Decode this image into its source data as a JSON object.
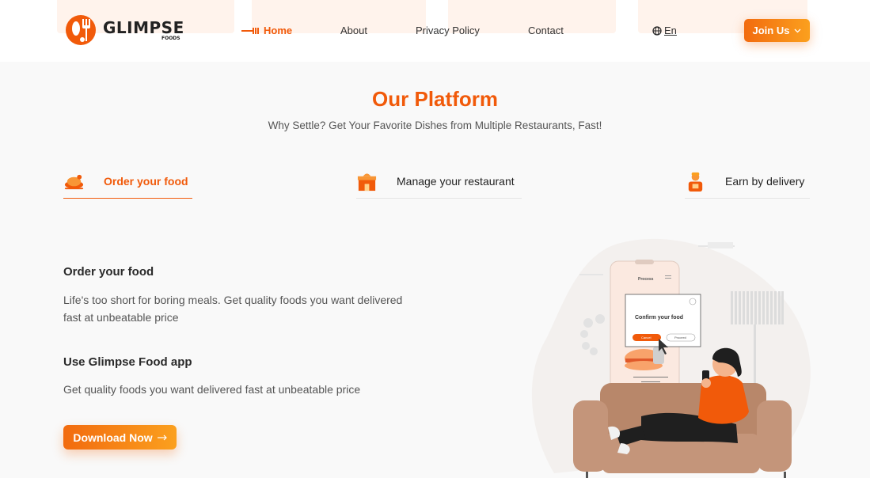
{
  "brand": {
    "name": "GLIMPSE",
    "sub": "FOODS"
  },
  "nav": {
    "home": "Home",
    "about": "About",
    "privacy": "Privacy Policy",
    "contact": "Contact",
    "language": "En",
    "join": "Join Us"
  },
  "section": {
    "title": "Our Platform",
    "subtitle": "Why Settle? Get Your Favorite Dishes from Multiple Restaurants, Fast!"
  },
  "tabs": [
    {
      "label": "Order your food",
      "icon": "chicken-icon",
      "active": true
    },
    {
      "label": "Manage your restaurant",
      "icon": "restaurant-icon",
      "active": false
    },
    {
      "label": "Earn by delivery",
      "icon": "delivery-person-icon",
      "active": false
    }
  ],
  "content": {
    "block1_title": "Order your food",
    "block1_text": "Life's too short for boring meals. Get quality foods you want delivered fast at unbeatable price",
    "block2_title": "Use Glimpse Food app",
    "block2_text": "Get quality foods you want delivered fast at unbeatable price",
    "download": "Download Now"
  },
  "illustration": {
    "phone_header": "Process",
    "dialog_title": "Confirm your food",
    "cancel": "Cancel",
    "proceed": "Proceed"
  },
  "colors": {
    "accent": "#f15a0a",
    "accent_light": "#fba01e",
    "sofa": "#b8876a"
  }
}
